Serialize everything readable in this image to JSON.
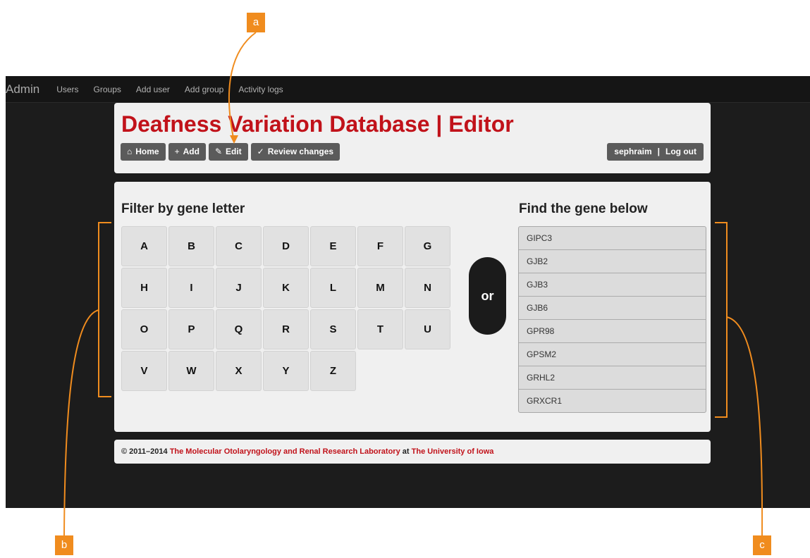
{
  "nav": {
    "brand": "Admin",
    "links": [
      "Users",
      "Groups",
      "Add user",
      "Add group",
      "Activity logs"
    ]
  },
  "header": {
    "title": "Deafness Variation Database | Editor",
    "buttons": [
      {
        "icon": "home-icon",
        "glyph": "⌂",
        "label": "Home"
      },
      {
        "icon": "plus-icon",
        "glyph": "+",
        "label": "Add"
      },
      {
        "icon": "pencil-icon",
        "glyph": "✎",
        "label": "Edit"
      },
      {
        "icon": "review-icon",
        "glyph": "✓",
        "label": "Review changes"
      }
    ],
    "user": "sephraim",
    "user_separator": "|",
    "logout": "Log out"
  },
  "filter": {
    "heading": "Filter by gene letter",
    "letters": [
      "A",
      "B",
      "C",
      "D",
      "E",
      "F",
      "G",
      "H",
      "I",
      "J",
      "K",
      "L",
      "M",
      "N",
      "O",
      "P",
      "Q",
      "R",
      "S",
      "T",
      "U",
      "V",
      "W",
      "X",
      "Y",
      "Z"
    ]
  },
  "or_label": "or",
  "find": {
    "heading": "Find the gene below",
    "genes": [
      "GIPC3",
      "GJB2",
      "GJB3",
      "GJB6",
      "GPR98",
      "GPSM2",
      "GRHL2",
      "GRXCR1"
    ]
  },
  "footer": {
    "copyright": "© 2011–2014",
    "lab": "The Molecular Otolaryngology and Renal Research Laboratory",
    "at": "at",
    "university": "The University of Iowa"
  },
  "callouts": [
    "a",
    "b",
    "c"
  ],
  "colors": {
    "accent": "#f08c1e",
    "title_red": "#c1121a",
    "background": "#1c1c1c",
    "button": "#5b5b5b"
  }
}
